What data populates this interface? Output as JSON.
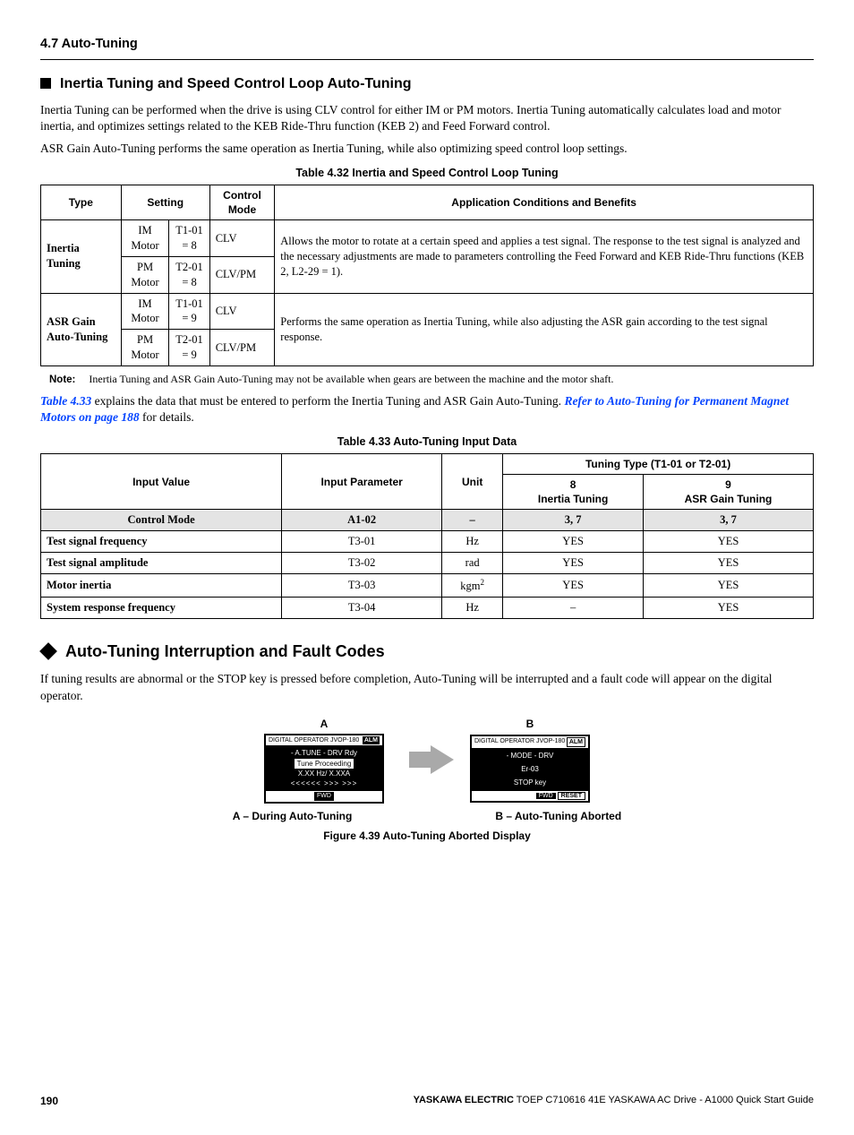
{
  "section_tag": "4.7 Auto-Tuning",
  "sub1_title": "Inertia Tuning and Speed Control Loop Auto-Tuning",
  "para1": "Inertia Tuning can be performed when the drive is using CLV control for either IM or PM motors. Inertia Tuning automatically calculates load and motor inertia, and optimizes settings related to the KEB Ride-Thru function (KEB 2) and Feed Forward control.",
  "para2": "ASR Gain Auto-Tuning performs the same operation as Inertia Tuning, while also optimizing speed control loop settings.",
  "table432": {
    "caption": "Table 4.32  Inertia and Speed Control Loop Tuning",
    "headers": [
      "Type",
      "Setting",
      "Control Mode",
      "Application Conditions and Benefits"
    ],
    "rows": [
      {
        "type": "Inertia Tuning",
        "cells": [
          {
            "motor": "IM Motor",
            "set": "T1-01 = 8",
            "mode": "CLV"
          },
          {
            "motor": "PM Motor",
            "set": "T2-01 = 8",
            "mode": "CLV/PM"
          }
        ],
        "app": "Allows the motor to rotate at a certain speed and applies a test signal. The response to the test signal is analyzed and the necessary adjustments are made to parameters controlling the Feed Forward and KEB Ride-Thru functions (KEB 2, L2-29 = 1)."
      },
      {
        "type": "ASR Gain Auto-Tuning",
        "cells": [
          {
            "motor": "IM Motor",
            "set": "T1-01 = 9",
            "mode": "CLV"
          },
          {
            "motor": "PM Motor",
            "set": "T2-01 = 9",
            "mode": "CLV/PM"
          }
        ],
        "app": "Performs the same operation as Inertia Tuning, while also adjusting the ASR gain according to the test signal response."
      }
    ]
  },
  "note_label": "Note:",
  "note_text": "Inertia Tuning and ASR Gain Auto-Tuning may not be available when gears are between the machine and the motor shaft.",
  "para3_pre": "Table 4.33",
  "para3_mid": " explains the data that must be entered to perform the Inertia Tuning and ASR Gain Auto-Tuning. ",
  "para3_link": "Refer to Auto-Tuning for Permanent Magnet Motors on page 188",
  "para3_post": " for details.",
  "table433": {
    "caption": "Table 4.33  Auto-Tuning Input Data",
    "h_input": "Input Value",
    "h_param": "Input Parameter",
    "h_unit": "Unit",
    "h_tt": "Tuning Type (T1-01 or T2-01)",
    "h_8a": "8",
    "h_8b": "Inertia Tuning",
    "h_9a": "9",
    "h_9b": "ASR Gain Tuning",
    "shade_row": [
      "Control Mode",
      "A1-02",
      "–",
      "3, 7",
      "3, 7"
    ],
    "rows": [
      [
        "Test signal frequency",
        "T3-01",
        "Hz",
        "YES",
        "YES"
      ],
      [
        "Test signal amplitude",
        "T3-02",
        "rad",
        "YES",
        "YES"
      ],
      [
        "Motor inertia",
        "T3-03",
        "kgm",
        "YES",
        "YES"
      ],
      [
        "System response frequency",
        "T3-04",
        "Hz",
        "–",
        "YES"
      ]
    ]
  },
  "main2_title": "Auto-Tuning Interruption and Fault Codes",
  "para4": "If tuning results are abnormal or the STOP key is pressed before completion, Auto-Tuning will be interrupted and a fault code will appear on the digital operator.",
  "fig": {
    "A_label": "A",
    "B_label": "B",
    "A_top": "DIGITAL OPERATOR  JVOP-180",
    "A_alm": "ALM",
    "A_l1": "- A.TUNE -   DRV  Rdy",
    "A_l2": "Tune Proceeding",
    "A_l3": "X.XX Hz/   X.XXA",
    "A_l4": "<<<<<<  >>>  >>>",
    "A_fwd": "FWD",
    "B_top": "DIGITAL OPERATOR  JVOP-180",
    "B_alm": "ALM",
    "B_l1": "- MODE -       DRV",
    "B_l2": "Er-03",
    "B_l3": "STOP  key",
    "B_fwd": "FWD",
    "B_reset": "RESET",
    "cap_A": "A – During Auto-Tuning",
    "cap_B": "B – Auto-Tuning Aborted",
    "caption": "Figure 4.39  Auto-Tuning Aborted Display"
  },
  "footer": {
    "page": "190",
    "brand": "YASKAWA ELECTRIC",
    "rest": " TOEP C710616 41E YASKAWA AC Drive - A1000 Quick Start Guide"
  }
}
